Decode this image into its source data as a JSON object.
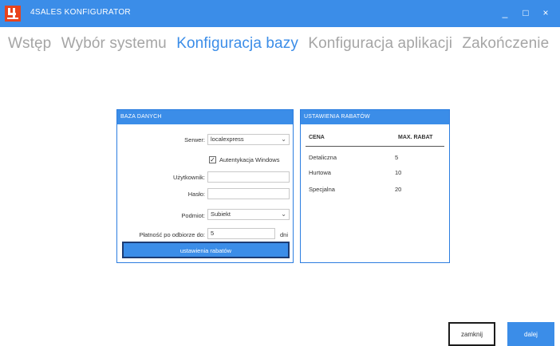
{
  "window": {
    "title": "4SALES KONFIGURATOR",
    "logo_icon": "4sales-logo-icon",
    "controls": {
      "minimize": "_",
      "maximize": "□",
      "close": "×"
    }
  },
  "steps": [
    {
      "label": "Wstęp",
      "active": false
    },
    {
      "label": "Wybór systemu",
      "active": false
    },
    {
      "label": "Konfiguracja bazy",
      "active": true
    },
    {
      "label": "Konfiguracja aplikacji",
      "active": false
    },
    {
      "label": "Zakończenie",
      "active": false
    }
  ],
  "db_panel": {
    "header": "BAZA DANYCH",
    "server_label": "Serwer:",
    "server_value": "localexpress",
    "auth_label": "Autentykacja Windows",
    "auth_checked": "✓",
    "user_label": "Użytkownik:",
    "user_value": "",
    "password_label": "Hasło:",
    "password_value": "",
    "entity_label": "Podmiot:",
    "entity_value": "Subiekt",
    "payment_label": "Płatność po odbiorze do:",
    "payment_value": "5",
    "payment_unit": "dni",
    "rabat_button": "ustawienia rabatów"
  },
  "rabat_panel": {
    "header": "USTAWIENIA RABATÓW",
    "col_price": "CENA",
    "col_rabat": "MAX. RABAT",
    "rows": [
      {
        "price": "Detaliczna",
        "rabat": "5"
      },
      {
        "price": "Hurtowa",
        "rabat": "10"
      },
      {
        "price": "Specjalna",
        "rabat": "20"
      }
    ]
  },
  "buttons": {
    "close": "zamknij",
    "next": "dalej"
  },
  "colors": {
    "accent": "#3b8de8",
    "inactive_step": "#a5a5a5",
    "dark_border": "#1c3c74"
  }
}
